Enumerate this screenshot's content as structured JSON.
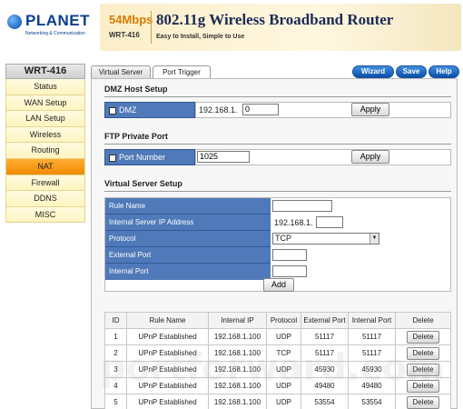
{
  "brand": {
    "name": "PLANET",
    "tagline": "Networking & Communication",
    "speed": "54Mbps",
    "model": "WRT-416",
    "product_title": "802.11g Wireless Broadband Router",
    "product_subtitle": "Easy to Install, Simple to Use"
  },
  "sidebar": {
    "model": "WRT-416",
    "items": [
      {
        "label": "Status"
      },
      {
        "label": "WAN Setup"
      },
      {
        "label": "LAN Setup"
      },
      {
        "label": "Wireless"
      },
      {
        "label": "Routing"
      },
      {
        "label": "NAT",
        "active": true
      },
      {
        "label": "Firewall"
      },
      {
        "label": "DDNS"
      },
      {
        "label": "MISC"
      }
    ]
  },
  "tabs": [
    {
      "label": "Virtual Server"
    },
    {
      "label": "Port Trigger",
      "active": true
    }
  ],
  "top_buttons": {
    "wizard": "Wizard",
    "save": "Save",
    "help": "Help"
  },
  "dmz": {
    "title": "DMZ Host Setup",
    "checkbox_label": "DMZ",
    "ip_prefix": "192.168.1.",
    "ip_value": "0",
    "apply": "Apply"
  },
  "ftp": {
    "title": "FTP Private Port",
    "checkbox_label": "Port Number",
    "value": "1025",
    "apply": "Apply"
  },
  "virtual_server": {
    "title": "Virtual Server Setup",
    "rule_name_label": "Rule Name",
    "rule_name_value": "",
    "ip_label": "Internal Server IP Address",
    "ip_prefix": "192.168.1.",
    "ip_value": "",
    "protocol_label": "Protocol",
    "protocol_value": "TCP",
    "external_port_label": "External Port",
    "external_port_value": "",
    "internal_port_label": "Internal Port",
    "internal_port_value": "",
    "add": "Add"
  },
  "table": {
    "headers": [
      "ID",
      "Rule Name",
      "Internal IP",
      "Protocol",
      "External Port",
      "Internal Port",
      "Delete"
    ],
    "rows": [
      {
        "id": "1",
        "rule": "UPnP Established",
        "ip": "192.168.1.100",
        "protocol": "UDP",
        "ext": "51117",
        "int": "51117",
        "delete": "Delete"
      },
      {
        "id": "2",
        "rule": "UPnP Established",
        "ip": "192.168.1.100",
        "protocol": "TCP",
        "ext": "51117",
        "int": "51117",
        "delete": "Delete"
      },
      {
        "id": "3",
        "rule": "UPnP Established",
        "ip": "192.168.1.100",
        "protocol": "UDP",
        "ext": "45930",
        "int": "45930",
        "delete": "Delete"
      },
      {
        "id": "4",
        "rule": "UPnP Established",
        "ip": "192.168.1.100",
        "protocol": "UDP",
        "ext": "49480",
        "int": "49480",
        "delete": "Delete"
      },
      {
        "id": "5",
        "rule": "UPnP Established",
        "ip": "192.168.1.100",
        "protocol": "UDP",
        "ext": "53554",
        "int": "53554",
        "delete": "Delete"
      }
    ]
  },
  "watermark": "portforward.com",
  "colors": {
    "accent": "#4f79b8",
    "nav_active": "#f08a00",
    "nav_bg": "#fff4c0",
    "banner": "#fbeec8"
  }
}
